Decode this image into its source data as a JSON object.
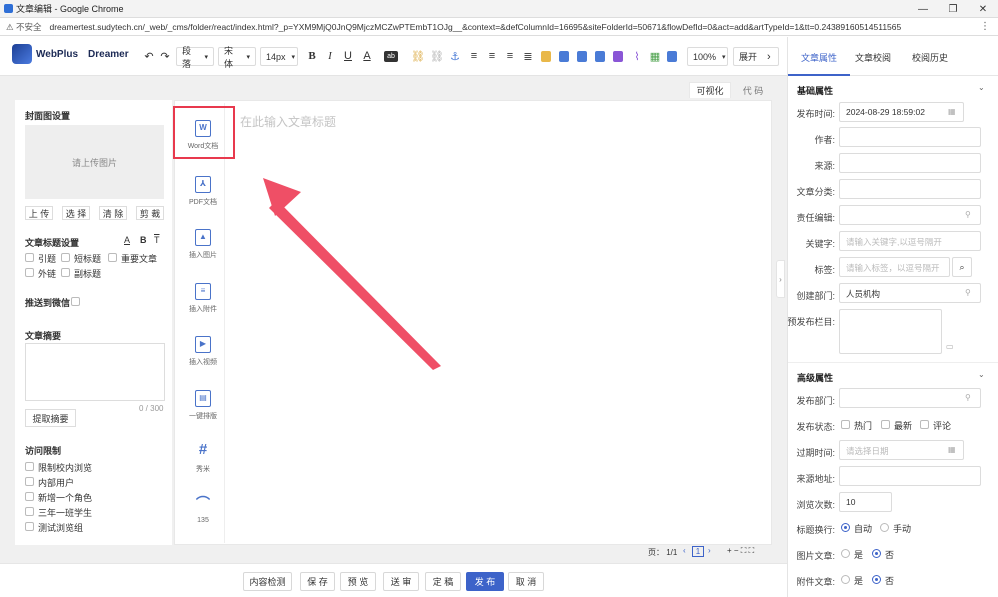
{
  "window": {
    "title": "文章编辑 - Google Chrome",
    "controls": [
      "—",
      "❐",
      "✕"
    ]
  },
  "address": {
    "insecure": "⚠ 不安全",
    "url": "dreamertest.sudytech.cn/_web/_cms/folder/react/index.html?_p=YXM9MjQ0JnQ9MjczMCZwPTEmbT1OJg__&context=&defColumnId=16695&siteFolderId=50671&flowDefId=0&act=add&artTypeId=1&tt=0.24389160514511565",
    "more": "⋮"
  },
  "app": {
    "logo1": "WebPlus",
    "logo2": "Dreamer"
  },
  "toolbar": {
    "undo": "↶",
    "redo": "↷",
    "paragraph": "段落",
    "font": "宋体",
    "size": "14px",
    "bold": "B",
    "italic": "I",
    "underline": "U",
    "color": "A",
    "bgcolor": "ab",
    "zoom": "100%",
    "expand": "展开",
    "expand_arrow": "›"
  },
  "content_tabs": {
    "visual": "可视化",
    "code": "代 码"
  },
  "left": {
    "cover_title": "封面图设置",
    "upload_placeholder": "请上传图片",
    "cover_buttons": [
      "上 传",
      "选 择",
      "清 除",
      "剪 裁"
    ],
    "title_settings": "文章标题设置",
    "style_icons": [
      "A",
      "B",
      "T"
    ],
    "title_options": [
      "引题",
      "短标题",
      "重要文章",
      "外链",
      "副标题"
    ],
    "push_wechat": "推送到微信",
    "summary_title": "文章摘要",
    "summary_count": "0 / 300",
    "extract_button": "提取摘要",
    "access_title": "访问限制",
    "access_options": [
      "限制校内浏览",
      "内部用户",
      "新增一个角色",
      "三年一班学生",
      "测试浏览组"
    ]
  },
  "insert_tools": [
    {
      "label": "Word文档",
      "glyph": "W"
    },
    {
      "label": "PDF文档",
      "glyph": "⅄"
    },
    {
      "label": "插入图片",
      "glyph": "▲"
    },
    {
      "label": "插入附件",
      "glyph": "≡"
    },
    {
      "label": "插入视频",
      "glyph": "▶"
    },
    {
      "label": "一键排版",
      "glyph": "▤"
    },
    {
      "label": "秀米",
      "glyph": "#"
    },
    {
      "label": "135",
      "glyph": "⌒"
    }
  ],
  "editor": {
    "title_placeholder": "在此输入文章标题"
  },
  "status": {
    "page_label": "页： 1/1",
    "page_num": "1",
    "zoom_icons": "+ − ⛶ ⛶"
  },
  "bottom_buttons": [
    "内容检测",
    "保 存",
    "预 览",
    "送 审",
    "定 稿",
    "发 布",
    "取 消"
  ],
  "right": {
    "tabs": [
      "文章属性",
      "文章校阅",
      "校阅历史"
    ],
    "basic_title": "基础属性",
    "publish_time_label": "发布时间:",
    "publish_time": "2024-08-29 18:59:02",
    "author_label": "作者:",
    "source_label": "来源:",
    "category_label": "文章分类:",
    "editor_label": "责任编辑:",
    "keywords_label": "关键字:",
    "keywords_ph": "请输入关键字,以逗号隔开",
    "tags_label": "标签:",
    "tags_ph": "请输入标签，以逗号隔开",
    "dept_label": "创建部门:",
    "dept_value": "人员机构",
    "precol_label": "预发布栏目:",
    "adv_title": "高级属性",
    "pub_dept_label": "发布部门:",
    "status_label": "发布状态:",
    "status_options": [
      "热门",
      "最新",
      "评论"
    ],
    "expire_label": "过期时间:",
    "expire_ph": "请选择日期",
    "src_url_label": "来源地址:",
    "views_label": "浏览次数:",
    "views": "10",
    "wrap_label": "标题换行:",
    "wrap_auto": "自动",
    "wrap_manual": "手动",
    "img_label": "图片文章:",
    "yes": "是",
    "no": "否",
    "att_label": "附件文章:"
  },
  "colors": {
    "accent": "#3d63c9",
    "highlight": "#e8394d"
  }
}
